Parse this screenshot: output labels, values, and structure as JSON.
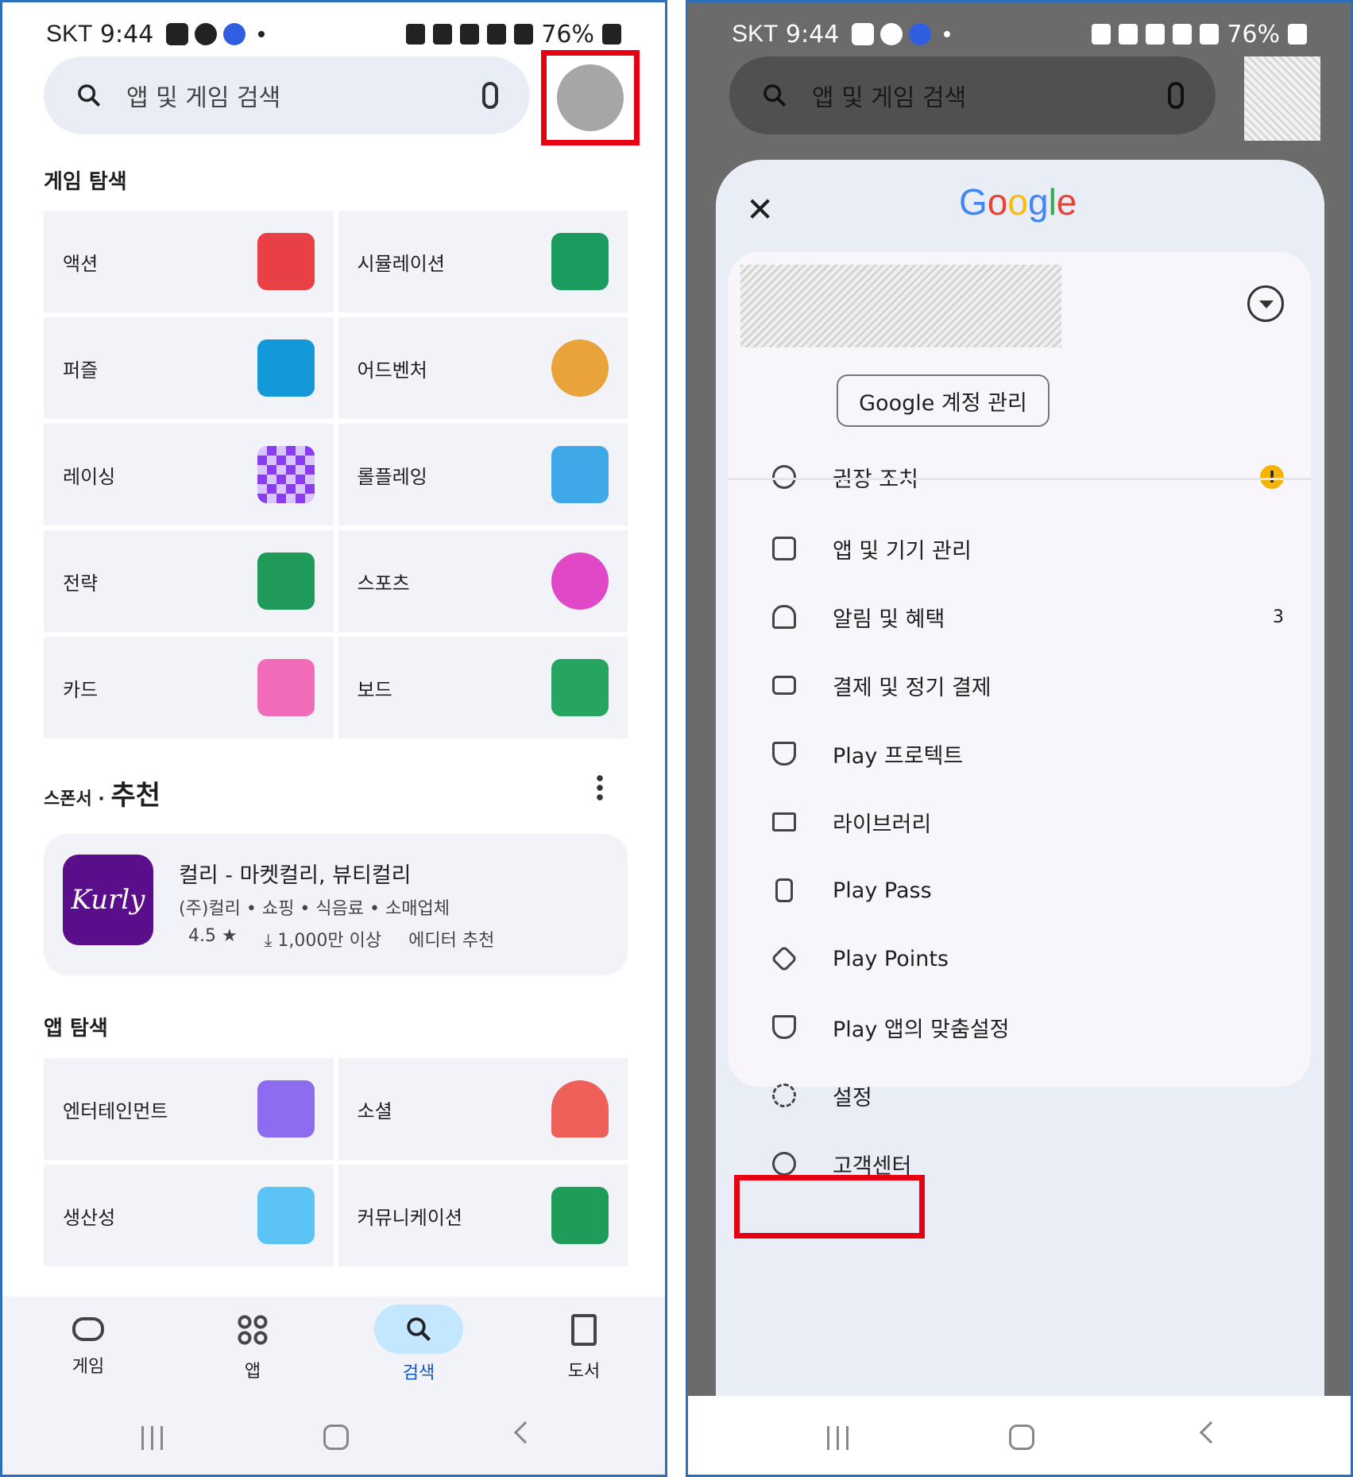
{
  "status": {
    "carrier": "SKT",
    "time": "9:44",
    "battery": "76%"
  },
  "search": {
    "placeholder": "앱 및 게임 검색"
  },
  "left": {
    "games_section_title": "게임 탐색",
    "game_categories": [
      "액션",
      "시뮬레이션",
      "퍼즐",
      "어드벤처",
      "레이싱",
      "롤플레잉",
      "전략",
      "스포츠",
      "카드",
      "보드"
    ],
    "sponsor_label": "스폰서",
    "sponsor_dot": "·",
    "recommend_title": "추천",
    "ad_app": {
      "icon_text": "Kurly",
      "title": "컬리 - 마켓컬리, 뷰티컬리",
      "meta": "(주)컬리 • 쇼핑 • 식음료 • 소매업체",
      "rating": "4.5 ★",
      "downloads": "⤓ 1,000만 이상",
      "badge": "에디터 추천"
    },
    "apps_section_title": "앱 탐색",
    "app_categories": [
      "엔터테인먼트",
      "소셜",
      "생산성",
      "커뮤니케이션"
    ],
    "nav": [
      "게임",
      "앱",
      "검색",
      "도서"
    ]
  },
  "right": {
    "logo": "Google",
    "manage_account": "Google 계정 관리",
    "menu": [
      {
        "label": "권장 조치",
        "trail": "!"
      },
      {
        "label": "앱 및 기기 관리",
        "trail": ""
      },
      {
        "label": "알림 및 혜택",
        "trail": "3"
      },
      {
        "label": "결제 및 정기 결제",
        "trail": ""
      },
      {
        "label": "Play 프로텍트",
        "trail": ""
      },
      {
        "label": "라이브러리",
        "trail": ""
      },
      {
        "label": "Play Pass",
        "trail": ""
      },
      {
        "label": "Play Points",
        "trail": ""
      },
      {
        "label": "Play 앱의 맞춤설정",
        "trail": ""
      },
      {
        "label": "설정",
        "trail": ""
      },
      {
        "label": "고객센터",
        "trail": ""
      }
    ]
  },
  "colors": {
    "highlight": "#e60012",
    "accent": "#c2e7ff",
    "warning": "#f4b400",
    "kurly": "#5a0e8a"
  }
}
